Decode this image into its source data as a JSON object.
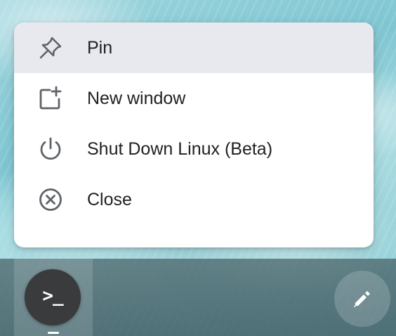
{
  "context_menu": {
    "items": [
      {
        "label": "Pin",
        "icon": "pin-icon",
        "selected": true
      },
      {
        "label": "New window",
        "icon": "new-window-icon",
        "selected": false
      },
      {
        "label": "Shut Down Linux (Beta)",
        "icon": "power-icon",
        "selected": false
      },
      {
        "label": "Close",
        "icon": "close-circle-icon",
        "selected": false
      }
    ]
  },
  "shelf": {
    "terminal_app": {
      "icon": "terminal-icon",
      "glyph": ">_"
    },
    "stylus_tools": {
      "icon": "stylus-icon"
    }
  },
  "colors": {
    "menu_background": "#ffffff",
    "selected_item": "#e8e9ee",
    "menu_text": "#202124",
    "icon_gray": "#5f6368",
    "terminal_app_background": "#3a3b3d"
  }
}
